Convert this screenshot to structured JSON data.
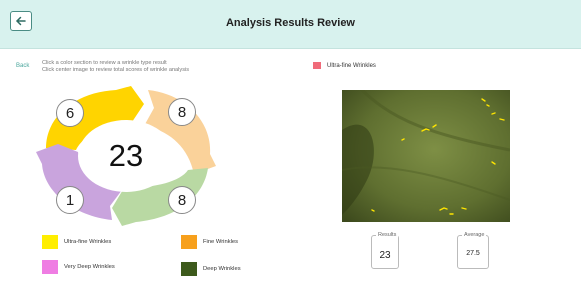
{
  "header": {
    "title": "Analysis Results Review",
    "back_icon": "arrow-left-icon"
  },
  "back_link": "Back",
  "instructions": [
    "Click a color section to review a wrinkle type result",
    "Click center image to review total scores of wrinkle analysis"
  ],
  "selected_legend": {
    "label": "Ultra-fine Wrinkles",
    "color": "#f06b7a"
  },
  "chart_data": {
    "type": "pie",
    "total": "23",
    "segments": [
      {
        "name": "Ultra-fine Wrinkles",
        "value": 6,
        "color": "#ffd400"
      },
      {
        "name": "Fine Wrinkles",
        "value": 8,
        "color": "#fad29a"
      },
      {
        "name": "Deep Wrinkles",
        "value": 8,
        "color": "#b9d9a3"
      },
      {
        "name": "Very Deep Wrinkles",
        "value": 1,
        "color": "#c9a4dd"
      }
    ]
  },
  "labels": {
    "ultra": "6",
    "fine": "8",
    "deep": "8",
    "very_deep": "1"
  },
  "legend": [
    {
      "label": "Ultra-fine Wrinkles",
      "color": "#ffee00"
    },
    {
      "label": "Fine Wrinkles",
      "color": "#f7a01c"
    },
    {
      "label": "Very Deep Wrinkles",
      "color": "#ef7de3"
    },
    {
      "label": "Deep Wrinkles",
      "color": "#3d5a1c"
    }
  ],
  "results": {
    "label": "Results",
    "value": "23"
  },
  "average": {
    "label": "Average",
    "value": "27.5"
  }
}
